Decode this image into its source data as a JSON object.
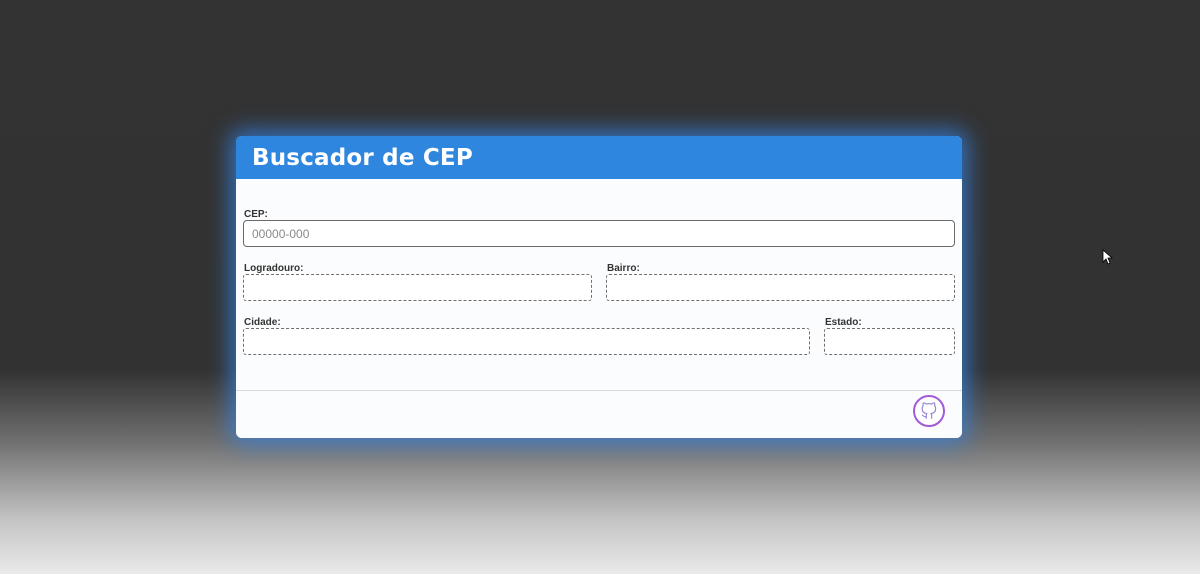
{
  "card": {
    "title": "Buscador de CEP"
  },
  "form": {
    "cep": {
      "label": "CEP:",
      "placeholder": "00000-000",
      "value": ""
    },
    "logradouro": {
      "label": "Logradouro:",
      "value": ""
    },
    "bairro": {
      "label": "Bairro:",
      "value": ""
    },
    "cidade": {
      "label": "Cidade:",
      "value": ""
    },
    "estado": {
      "label": "Estado:",
      "value": ""
    }
  },
  "footer": {
    "github_icon": "github-icon"
  },
  "colors": {
    "header": "#2f86df",
    "glow": "#3684e6",
    "github_ring": "#a25ad8"
  }
}
